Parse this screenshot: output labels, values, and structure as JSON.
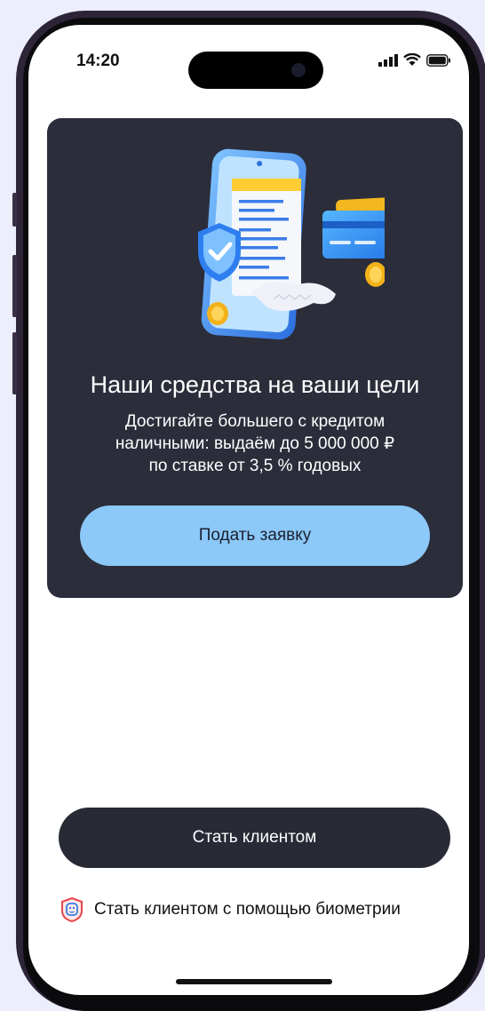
{
  "status_bar": {
    "time": "14:20",
    "icons": [
      "signal-icon",
      "wifi-icon",
      "battery-icon"
    ]
  },
  "promo": {
    "illustration": "phone-receipt-card-coins-illustration",
    "title": "Наши средства на ваши цели",
    "text_lines": [
      "Достигайте большего с кредитом",
      "наличными: выдаём до 5 000 000 ₽",
      "по ставке от 3,5  % годовых"
    ],
    "button_label": "Подать заявку"
  },
  "actions": {
    "become_client_label": "Стать клиентом",
    "biometry_label": "Стать клиентом с помощью биометрии",
    "biometry_icon": "face-id-icon"
  },
  "colors": {
    "card_bg": "#2b2d3a",
    "apply_button": "#8cc8f8",
    "primary_button": "#282a36",
    "page_bg": "#eceefb",
    "biometry_icon": "#e6454a"
  }
}
